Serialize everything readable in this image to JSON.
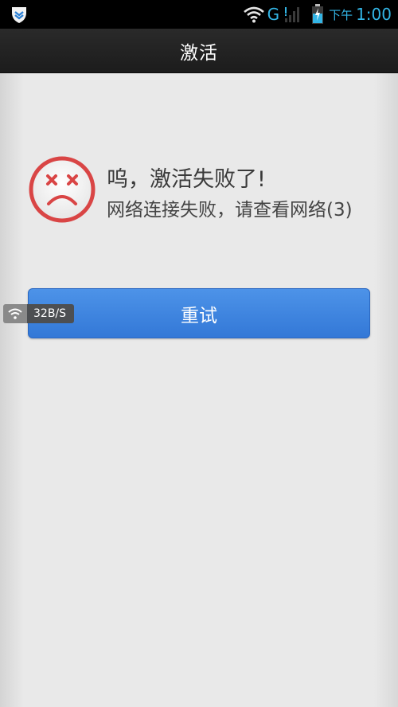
{
  "status_bar": {
    "network_type": "G",
    "clock_prefix": "下午",
    "clock": "1:00",
    "icons": [
      "shield-icon",
      "wifi-icon",
      "signal-icon",
      "battery-icon"
    ]
  },
  "title_bar": {
    "title": "激活"
  },
  "message": {
    "icon": "sad-face-icon",
    "title": "呜，激活失败了!",
    "detail": "网络连接失败，请查看网络(3)"
  },
  "retry_button": {
    "label": "重试"
  },
  "speed_widget": {
    "icon": "wifi-icon",
    "speed": "32B/S"
  },
  "colors": {
    "accent": "#33b5e5",
    "button": "#3d85df",
    "face": "#d94545",
    "background": "#e9e9e9"
  }
}
